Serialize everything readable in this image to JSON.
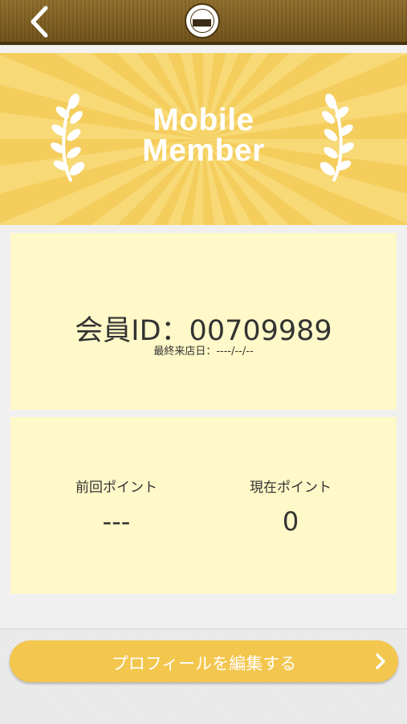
{
  "header": {
    "back_icon": "chevron-left-icon",
    "logo_icon": "shop-logo-icon"
  },
  "banner": {
    "title_line1": "Mobile",
    "title_line2": "Member",
    "decoration_icon": "laurel-wreath-icon",
    "colors": {
      "background": "#f4cd5c",
      "rays": "#f7d976",
      "text": "#ffffff"
    }
  },
  "member": {
    "id_text": "会員ID：00709989",
    "last_visit_text": "最終来店日：----/--/--"
  },
  "points": {
    "previous_label": "前回ポイント",
    "previous_value": "---",
    "current_label": "現在ポイント",
    "current_value": "0"
  },
  "actions": {
    "edit_profile_label": "プロフィールを編集する",
    "edit_profile_icon": "chevron-right-icon",
    "colors": {
      "button": "#f3c64e",
      "card": "#fff8c8"
    }
  }
}
